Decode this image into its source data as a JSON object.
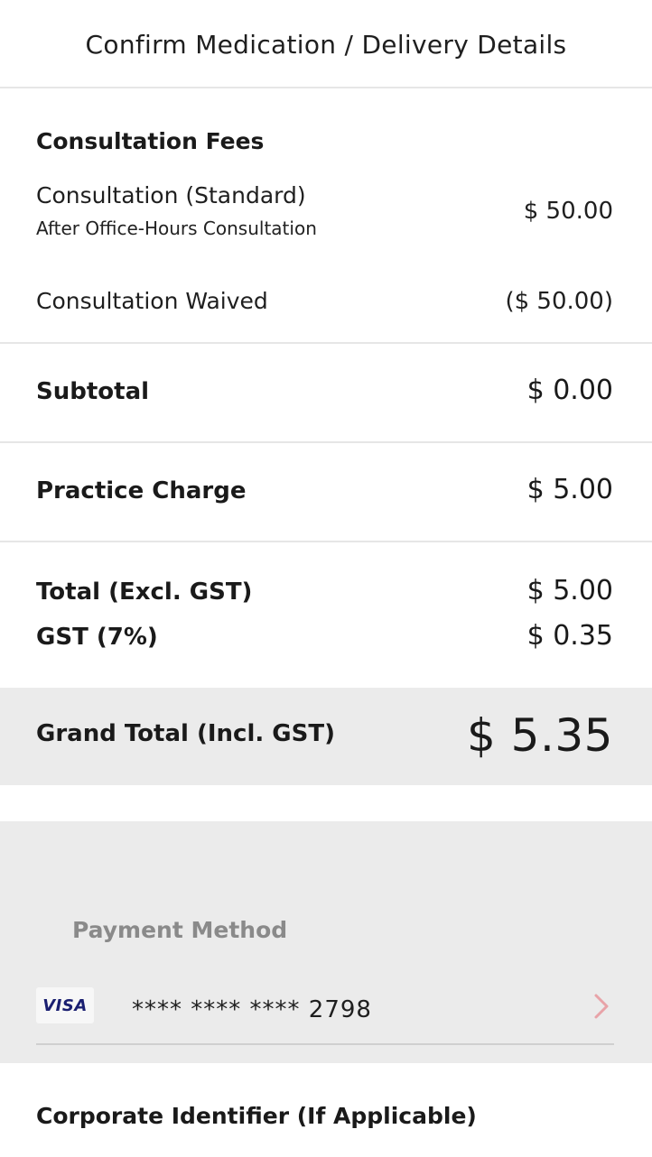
{
  "header": {
    "title": "Confirm Medication / Delivery Details"
  },
  "consultation": {
    "section_title": "Consultation Fees",
    "items": [
      {
        "label": "Consultation (Standard)",
        "sublabel": "After Office-Hours Consultation",
        "amount": "$ 50.00"
      },
      {
        "label": "Consultation Waived",
        "amount": "($ 50.00)"
      }
    ]
  },
  "subtotal": {
    "label": "Subtotal",
    "amount": "$ 0.00"
  },
  "practice_charge": {
    "label": "Practice Charge",
    "amount": "$ 5.00"
  },
  "totals": {
    "total_excl_label": "Total (Excl. GST)",
    "total_excl_amount": "$ 5.00",
    "gst_label": "GST (7%)",
    "gst_amount": "$ 0.35"
  },
  "grand_total": {
    "label": "Grand Total (Incl. GST)",
    "amount": "$ 5.35"
  },
  "payment": {
    "title": "Payment Method",
    "card_brand": "VISA",
    "card_number": "**** **** **** 2798",
    "chevron_icon": "chevron-right-icon",
    "chevron_color": "#e8a3a8"
  },
  "corporate": {
    "title": "Corporate Identifier (If Applicable)"
  }
}
